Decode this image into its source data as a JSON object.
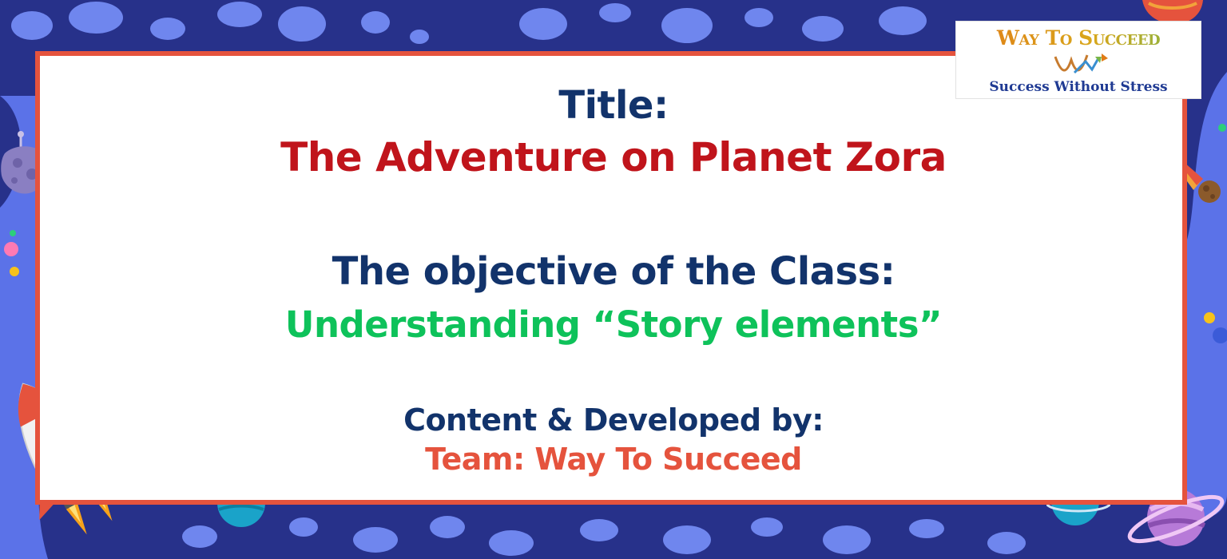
{
  "slide": {
    "title_label": "Title:",
    "story_title": "The Adventure on Planet Zora",
    "objective_label": "The objective of the Class:",
    "objective_value": "Understanding “Story elements”",
    "credit_label": "Content & Developed by:",
    "credit_value": "Team: Way To Succeed"
  },
  "logo": {
    "name": "Way To Succeed",
    "tagline": "Success Without Stress",
    "mark_icon": "wts-monogram-icon"
  },
  "icons": [
    "rocket-icon",
    "asteroid-icon",
    "comet-icon",
    "planet-icon",
    "ringed-planet-icon"
  ],
  "colors": {
    "navy_text": "#12336b",
    "red_text": "#c0141b",
    "green_text": "#0ec25a",
    "orange_text": "#e5533d",
    "frame_border": "#e5533d",
    "background_dark": "#27318a",
    "background_light": "#5b72e8",
    "logo_tagline": "#1f3a93"
  }
}
